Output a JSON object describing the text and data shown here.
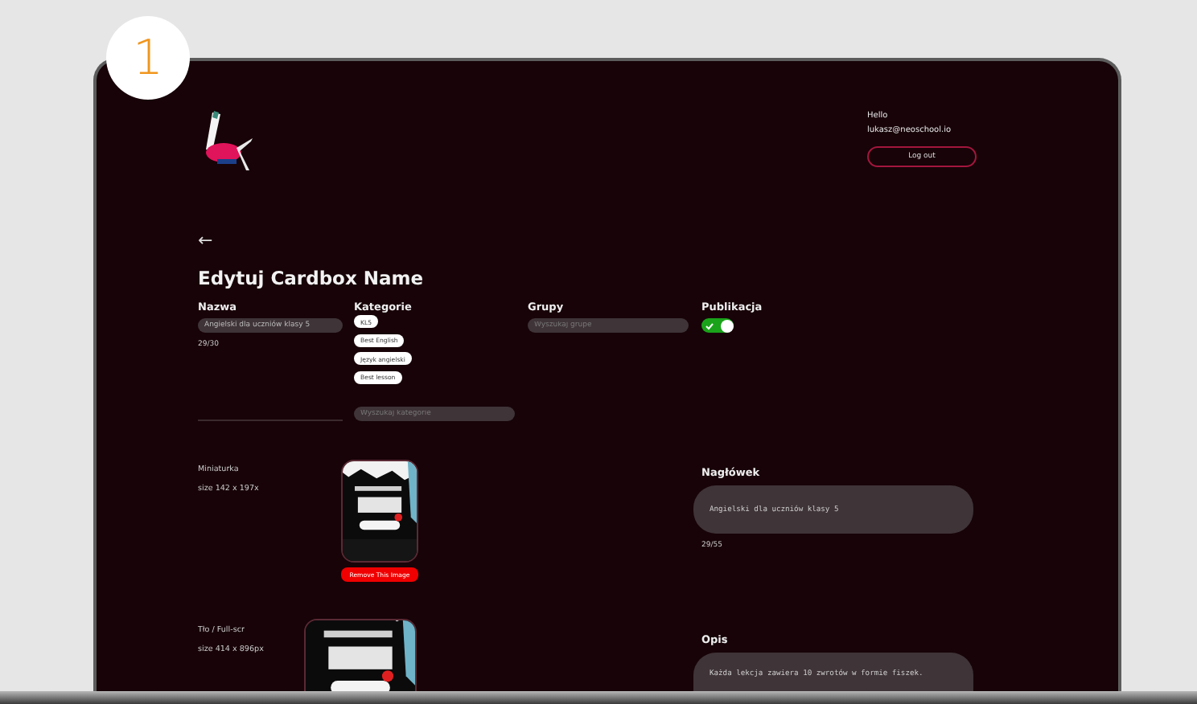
{
  "badge": "1",
  "user": {
    "greeting": "Hello",
    "email": "lukasz@neoschool.io"
  },
  "logout_button": "Log out",
  "back_arrow": "←",
  "title": "Edytuj Cardbox Name",
  "name": {
    "label": "Nazwa",
    "value": "Angielski dla uczniów klasy 5",
    "counter": "29/30"
  },
  "categories": {
    "label": "Kategorie",
    "tags": [
      "KL5",
      "Best English",
      "Język angielski",
      "Best lesson"
    ],
    "placeholder": "Wyszukaj kategorie"
  },
  "groups": {
    "label": "Grupy",
    "placeholder": "Wyszukaj grupe"
  },
  "publication": {
    "label": "Publikacja",
    "on": true
  },
  "thumbnail": {
    "label": "Miniaturka",
    "size": "size 142 x 197x",
    "remove_button": "Remove This Image"
  },
  "background": {
    "label": "Tło / Full-scr",
    "size": "size 414 x 896px"
  },
  "header": {
    "label": "Nagłówek",
    "value": "Angielski dla uczniów klasy 5",
    "counter": "29/55"
  },
  "description": {
    "label": "Opis",
    "value": "Każda lekcja zawiera 10 zwrotów w formie fiszek."
  }
}
